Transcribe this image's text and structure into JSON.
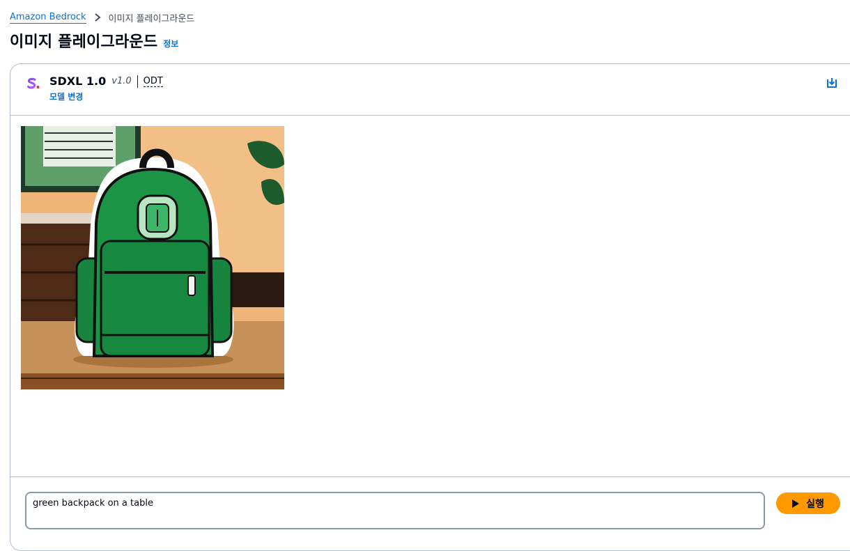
{
  "breadcrumb": {
    "root": "Amazon Bedrock",
    "current": "이미지 플레이그라운드"
  },
  "page": {
    "title": "이미지 플레이그라운드",
    "info": "정보"
  },
  "model": {
    "logo_letter": "S.",
    "name": "SDXL 1.0",
    "version": "v1.0",
    "mode": "ODT",
    "change_label": "모델 변경"
  },
  "prompt": {
    "value": "green backpack on a table"
  },
  "run_button": {
    "label": "실행"
  },
  "icons": {
    "breadcrumb_separator": "chevron-right-icon",
    "download": "download-icon",
    "run": "play-icon"
  },
  "colors": {
    "link": "#0972d3",
    "primary_button": "#ff9900",
    "border": "#b6bec9"
  }
}
